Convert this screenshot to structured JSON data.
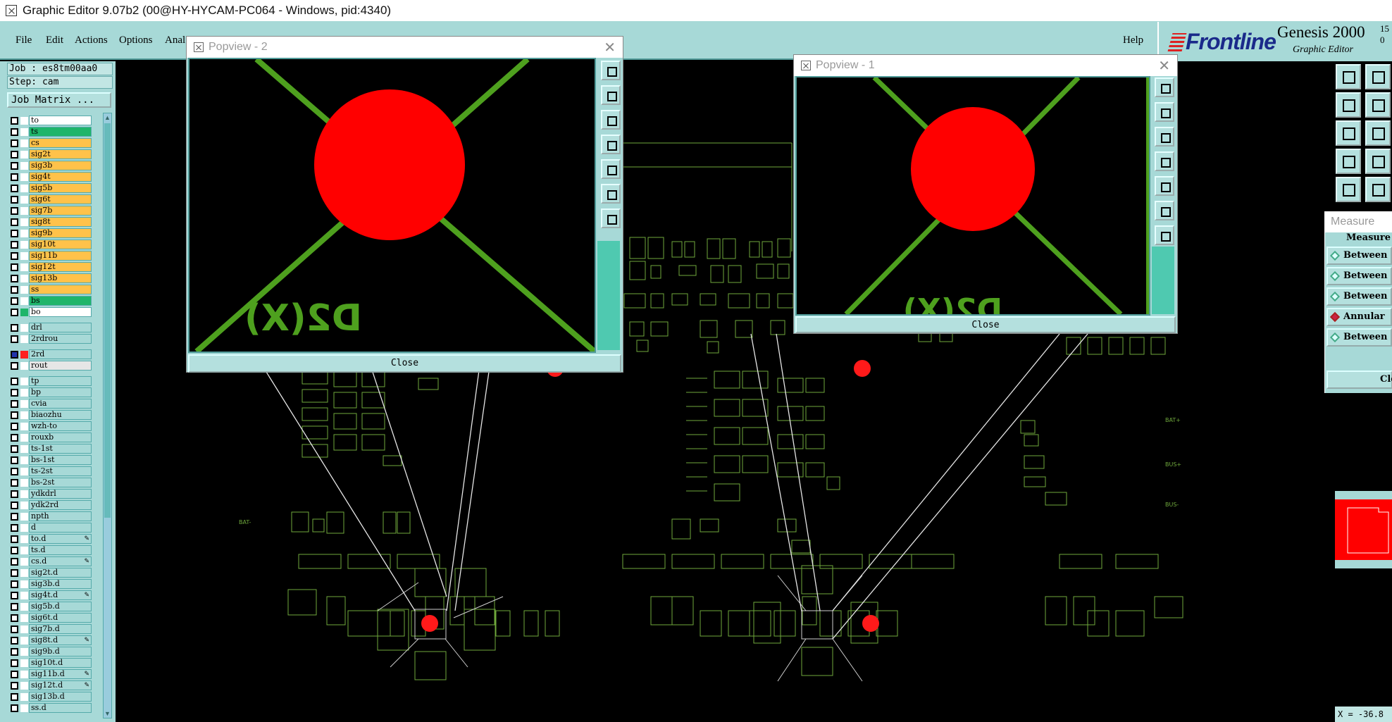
{
  "window": {
    "title": "Graphic Editor 9.07b2 (00@HY-HYCAM-PC064 - Windows, pid:4340)"
  },
  "menu": {
    "file": "File",
    "edit": "Edit",
    "actions": "Actions",
    "options": "Options",
    "analysis": "Anal",
    "help": "Help"
  },
  "brand": {
    "logo": "Frontline",
    "product": "Genesis 2000",
    "subtitle": "Graphic Editor",
    "version_top": "15",
    "version_bottom": "0"
  },
  "job": {
    "label": "Job : es8tm00aa0",
    "step": "Step: cam",
    "matrix_button": "Job Matrix ..."
  },
  "layers": {
    "board": [
      {
        "name": "to",
        "color": "#ffffff"
      },
      {
        "name": "ts",
        "color": "#1fb56a"
      },
      {
        "name": "cs",
        "color": "#ffc24a"
      },
      {
        "name": "sig2t",
        "color": "#ffc24a"
      },
      {
        "name": "sig3b",
        "color": "#ffc24a"
      },
      {
        "name": "sig4t",
        "color": "#ffc24a"
      },
      {
        "name": "sig5b",
        "color": "#ffc24a"
      },
      {
        "name": "sig6t",
        "color": "#ffc24a"
      },
      {
        "name": "sig7b",
        "color": "#ffc24a"
      },
      {
        "name": "sig8t",
        "color": "#ffc24a"
      },
      {
        "name": "sig9b",
        "color": "#ffc24a"
      },
      {
        "name": "sig10t",
        "color": "#ffc24a"
      },
      {
        "name": "sig11b",
        "color": "#ffc24a"
      },
      {
        "name": "sig12t",
        "color": "#ffc24a"
      },
      {
        "name": "sig13b",
        "color": "#ffc24a"
      },
      {
        "name": "ss",
        "color": "#ffc24a"
      },
      {
        "name": "bs",
        "color": "#1fb56a"
      },
      {
        "name": "bo",
        "color": "#ffffff"
      }
    ],
    "drill": [
      {
        "name": "drl",
        "color": "#a7d9d7"
      },
      {
        "name": "2rdrou",
        "color": "#a7d9d7"
      }
    ],
    "rout": [
      {
        "name": "2rd",
        "color": "#a7d9d7"
      },
      {
        "name": "rout",
        "color": "#e6e6e6"
      }
    ],
    "misc": [
      {
        "name": "tp"
      },
      {
        "name": "bp"
      },
      {
        "name": "cvia"
      },
      {
        "name": "biaozhu"
      },
      {
        "name": "wzh-to"
      },
      {
        "name": "rouxb"
      },
      {
        "name": "ts-1st"
      },
      {
        "name": "bs-1st"
      },
      {
        "name": "ts-2st"
      },
      {
        "name": "bs-2st"
      },
      {
        "name": "ydkdrl"
      },
      {
        "name": "ydk2rd"
      },
      {
        "name": "npth"
      },
      {
        "name": "d"
      },
      {
        "name": "to.d"
      },
      {
        "name": "ts.d"
      },
      {
        "name": "cs.d"
      },
      {
        "name": "sig2t.d"
      },
      {
        "name": "sig3b.d"
      },
      {
        "name": "sig4t.d"
      },
      {
        "name": "sig5b.d"
      },
      {
        "name": "sig6t.d"
      },
      {
        "name": "sig7b.d"
      },
      {
        "name": "sig8t.d"
      },
      {
        "name": "sig9b.d"
      },
      {
        "name": "sig10t.d"
      },
      {
        "name": "sig11b.d"
      },
      {
        "name": "sig12t.d"
      },
      {
        "name": "sig13b.d"
      },
      {
        "name": "ss.d"
      }
    ]
  },
  "popview2": {
    "title": "Popview - 2",
    "close": "Close",
    "label": "D2(X)"
  },
  "popview1": {
    "title": "Popview - 1",
    "close": "Close",
    "label": "D2(X)"
  },
  "measure": {
    "title": "Measure",
    "header": "Measure",
    "buttons": [
      "Between",
      "Between",
      "Between",
      "Annular",
      "Between"
    ],
    "close": "Clo"
  },
  "coords": "X = -36.8",
  "colors": {
    "pad": "#ff0000",
    "trace": "#4ea01e",
    "outline": "#7fb34a",
    "panel": "#a7d9d7"
  }
}
